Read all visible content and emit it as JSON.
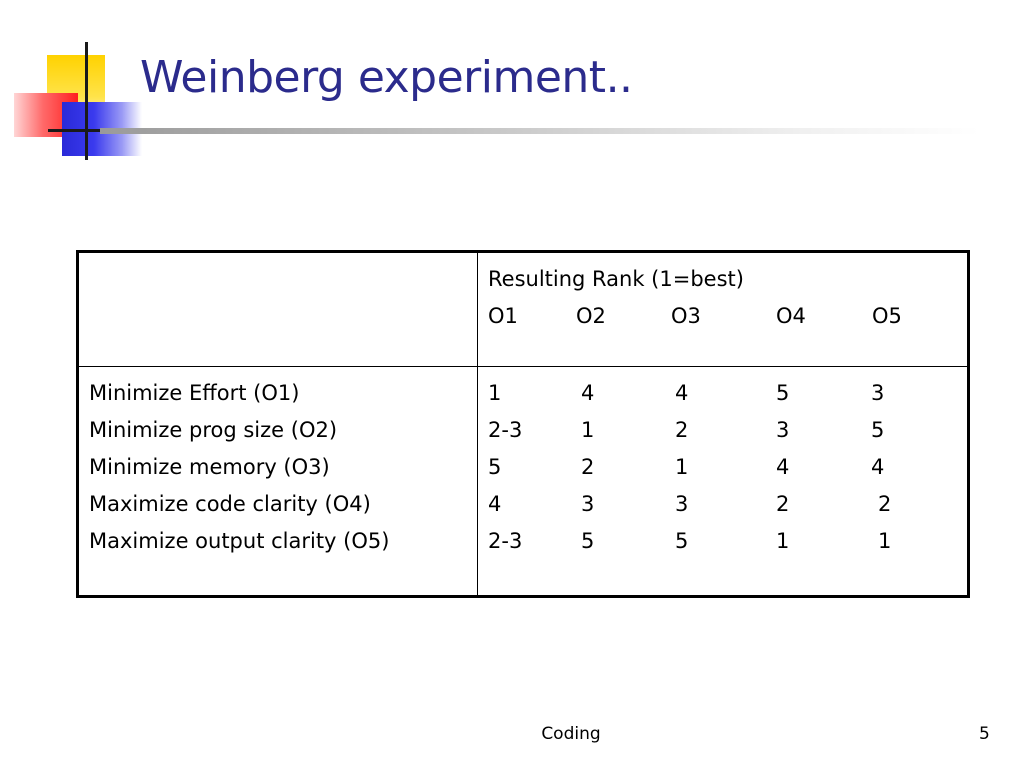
{
  "slide": {
    "title": "Weinberg experiment..",
    "footer_center": "Coding",
    "page_number": "5"
  },
  "table": {
    "header_title": "Resulting Rank (1=best)",
    "columns": [
      "O1",
      "O2",
      "O3",
      "O4",
      "O5"
    ],
    "rows": [
      {
        "objective": "Minimize Effort (O1)",
        "ranks": [
          "1",
          "4",
          "4",
          "5",
          "3"
        ]
      },
      {
        "objective": "Minimize prog size (O2)",
        "ranks": [
          "2-3",
          "1",
          "2",
          "3",
          "5"
        ]
      },
      {
        "objective": "Minimize memory (O3)",
        "ranks": [
          "5",
          "2",
          "1",
          "4",
          "4"
        ]
      },
      {
        "objective": "Maximize code clarity (O4)",
        "ranks": [
          "4",
          "3",
          "3",
          "2",
          "2"
        ]
      },
      {
        "objective": "Maximize output clarity (O5)",
        "ranks": [
          "2-3",
          "5",
          "5",
          "1",
          "1"
        ]
      }
    ]
  }
}
